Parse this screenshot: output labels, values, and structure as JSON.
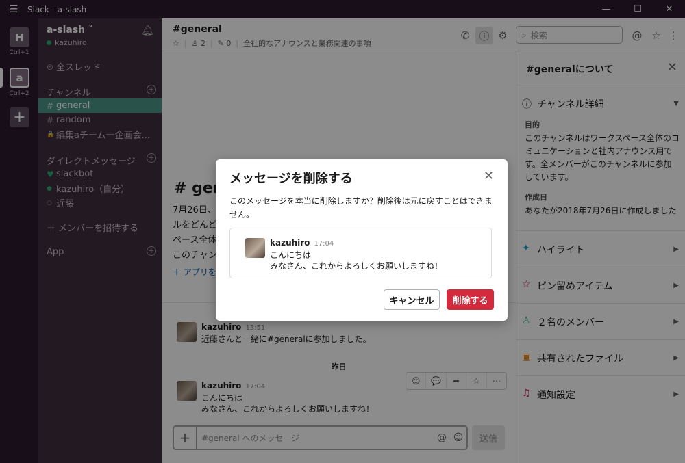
{
  "window": {
    "title": "Slack - a-slash",
    "menu_icon": "☰",
    "minimize": "—",
    "maximize": "☐",
    "close": "✕"
  },
  "workspaces": [
    {
      "letter": "H",
      "shortcut": "Ctrl+1"
    },
    {
      "letter": "a",
      "shortcut": "Ctrl+2"
    }
  ],
  "add_workspace": "+",
  "sidebar": {
    "team_name": "a-slash ˅",
    "user": "kazuhiro",
    "all_threads": "全スレッド",
    "channels_header": "チャンネル",
    "channels": [
      {
        "prefix": "#",
        "name": "general"
      },
      {
        "prefix": "#",
        "name": "random"
      },
      {
        "prefix": "🔒",
        "name": "編集aチーム一企画会..."
      }
    ],
    "dm_header": "ダイレクトメッセージ",
    "dms": [
      {
        "prefix": "♥",
        "name": "slackbot"
      },
      {
        "prefix": "●",
        "name": "kazuhiro（自分）"
      },
      {
        "prefix": "○",
        "name": "近藤"
      }
    ],
    "invite": "＋ メンバーを招待する",
    "app_header": "App",
    "plus": "+"
  },
  "channel": {
    "name": "#general",
    "star": "☆",
    "members": "2",
    "pins": "0",
    "topic": "全社的なアナウンスと業務関連の事項",
    "intro_title": "# gene",
    "intro_lines": [
      "7月26日、",
      "ルをどんど",
      "ペース全体",
      "このチャン"
    ],
    "add_app": "＋ アプリを追"
  },
  "header_icons": {
    "call": "✆",
    "info": "ⓘ",
    "settings": "⚙",
    "at": "@",
    "star": "☆",
    "more": "⋮"
  },
  "search": {
    "icon": "⌕",
    "placeholder": "検索"
  },
  "messages": [
    {
      "author": "kazuhiro",
      "time": "13:51",
      "lines": [
        "近藤さんと一緒に#generalに参加しました。"
      ]
    },
    {
      "author": "kazuhiro",
      "time": "17:04",
      "lines": [
        "こんにちは",
        "みなさん、これからよろしくお願いしますね！"
      ]
    }
  ],
  "date_separator": "昨日",
  "hover_actions": [
    "☺",
    "💬",
    "➦",
    "☆",
    "⋯"
  ],
  "composer": {
    "plus": "+",
    "placeholder": "#general へのメッセージ",
    "at": "@",
    "emoji": "☺",
    "send": "送信"
  },
  "details": {
    "title": "#generalについて",
    "close": "✕",
    "channel_details": "チャンネル詳細",
    "purpose_label": "目的",
    "purpose_text": "このチャンネルはワークスペース全体のコミュニケーションと社内アナウンス用です。全メンバーがこのチャンネルに参加しています。",
    "created_label": "作成日",
    "created_text": "あなたが2018年7月26日に作成しました",
    "sections": [
      {
        "icon": "✦",
        "label": "ハイライト",
        "color": "#1d9bd1"
      },
      {
        "icon": "☆",
        "label": "ピン留めアイテム",
        "color": "#e01e5a"
      },
      {
        "icon": "♙",
        "label": "２名のメンバー",
        "color": "#2bac76"
      },
      {
        "icon": "▣",
        "label": "共有されたファイル",
        "color": "#e8912d"
      },
      {
        "icon": "♫",
        "label": "通知設定",
        "color": "#e01e5a"
      }
    ]
  },
  "modal": {
    "title": "メッセージを削除する",
    "close": "✕",
    "body": "このメッセージを本当に削除しますか？削除後は元に戻すことはできません。",
    "quoted": {
      "author": "kazuhiro",
      "time": "17:04",
      "lines": [
        "こんにちは",
        "みなさん、これからよろしくお願いしますね！"
      ]
    },
    "cancel": "キャンセル",
    "delete": "削除する"
  }
}
